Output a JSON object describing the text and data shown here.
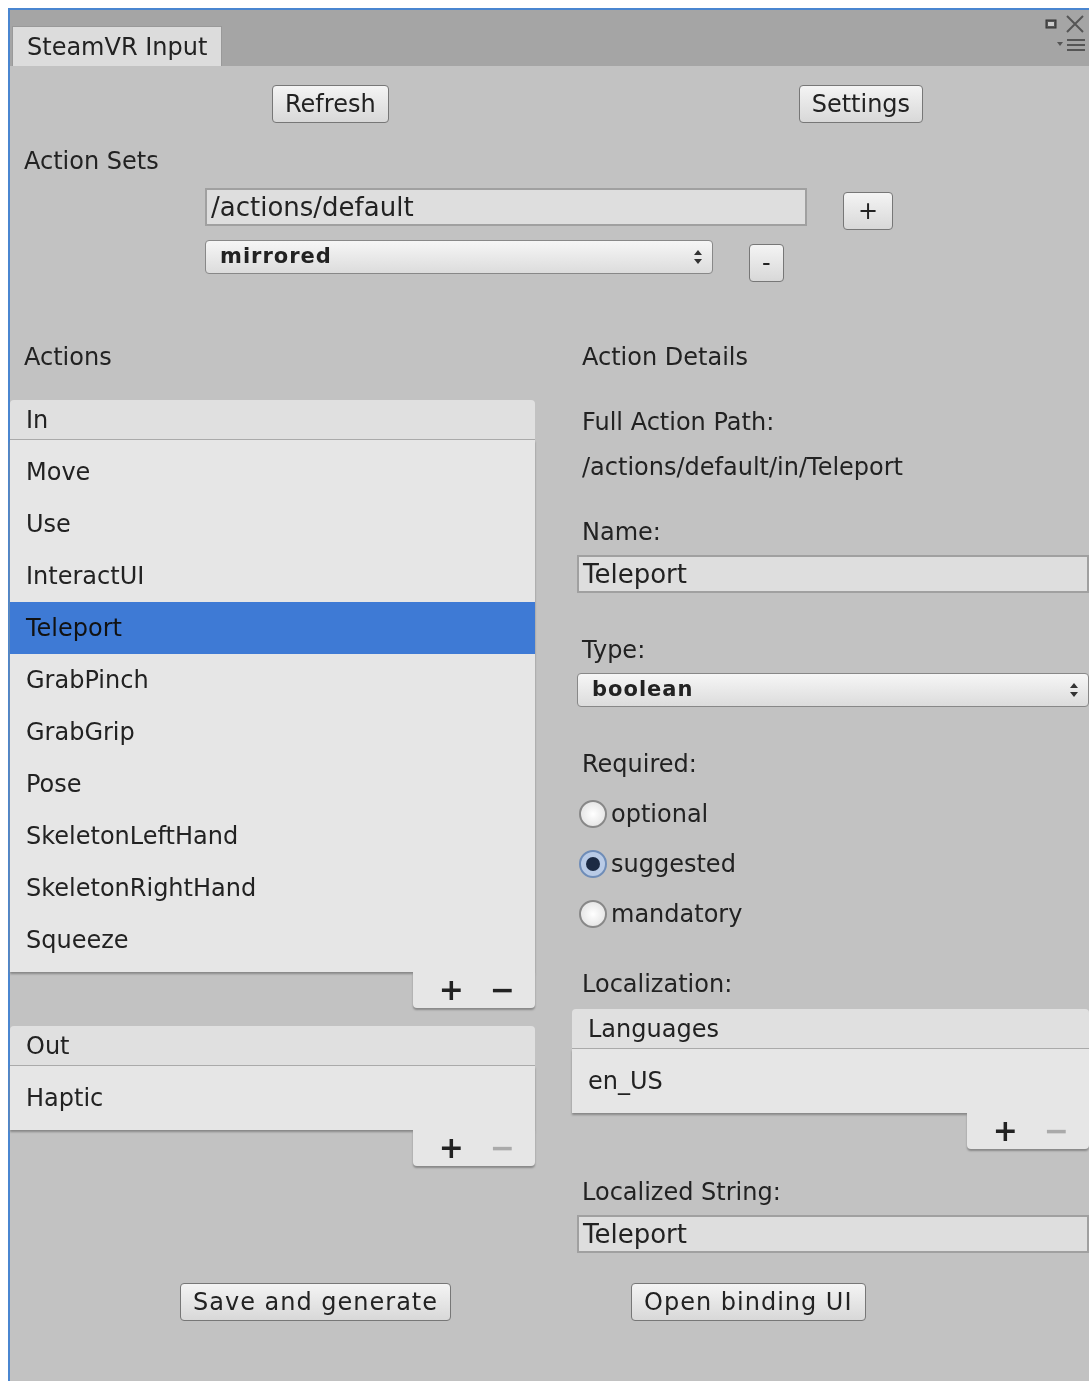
{
  "window": {
    "tab": "SteamVR Input"
  },
  "toolbar": [
    {
      "label": "Refresh"
    },
    {
      "label": "Settings"
    }
  ],
  "action_sets": {
    "label": "Action Sets",
    "name": "/actions/default",
    "add": "+",
    "mode": "mirrored",
    "remove": "-"
  },
  "actions": {
    "label": "Actions",
    "lists": [
      {
        "header": "In",
        "items": [
          {
            "label": "Move",
            "selected": false
          },
          {
            "label": "Use",
            "selected": false
          },
          {
            "label": "InteractUI",
            "selected": false
          },
          {
            "label": "Teleport",
            "selected": true
          },
          {
            "label": "GrabPinch",
            "selected": false
          },
          {
            "label": "GrabGrip",
            "selected": false
          },
          {
            "label": "Pose",
            "selected": false
          },
          {
            "label": "SkeletonLeftHand",
            "selected": false
          },
          {
            "label": "SkeletonRightHand",
            "selected": false
          },
          {
            "label": "Squeeze",
            "selected": false
          }
        ],
        "add": "+",
        "remove": "−",
        "remove_disabled": false
      },
      {
        "header": "Out",
        "items": [
          {
            "label": "Haptic",
            "selected": false
          }
        ],
        "add": "+",
        "remove": "−",
        "remove_disabled": true
      }
    ]
  },
  "details": {
    "label": "Action Details",
    "path_label": "Full Action Path:",
    "path": "/actions/default/in/Teleport",
    "name_label": "Name:",
    "name": "Teleport",
    "type_label": "Type:",
    "type": "boolean",
    "required_label": "Required:",
    "required": [
      {
        "label": "optional",
        "selected": false
      },
      {
        "label": "suggested",
        "selected": true
      },
      {
        "label": "mandatory",
        "selected": false
      }
    ],
    "localization_label": "Localization:",
    "languages": {
      "header": "Languages",
      "items": [
        "en_US"
      ],
      "add": "+",
      "remove": "−",
      "remove_disabled": true
    },
    "localized_label": "Localized String:",
    "localized": "Teleport"
  },
  "footer": [
    {
      "label": "Save and generate"
    },
    {
      "label": "Open binding UI"
    }
  ]
}
